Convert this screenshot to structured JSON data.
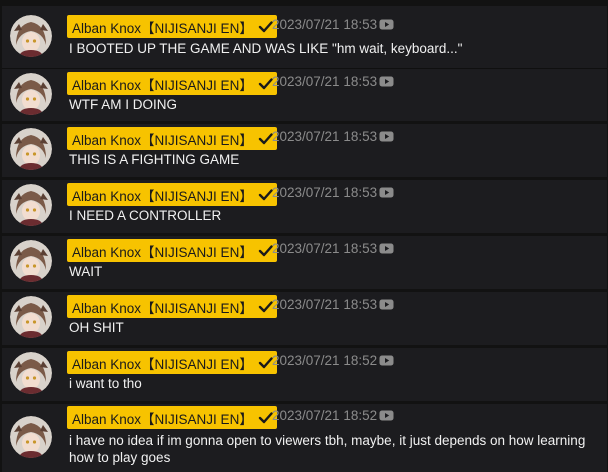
{
  "messages": [
    {
      "author": "Alban Knox【NIJISANJI EN】",
      "timestamp": "2023/07/21 18:53",
      "text": "I BOOTED UP THE GAME AND WAS LIKE \"hm wait, keyboard...\""
    },
    {
      "author": "Alban Knox【NIJISANJI EN】",
      "timestamp": "2023/07/21 18:53",
      "text": "WTF AM I DOING"
    },
    {
      "author": "Alban Knox【NIJISANJI EN】",
      "timestamp": "2023/07/21 18:53",
      "text": "THIS IS A FIGHTING GAME"
    },
    {
      "author": "Alban Knox【NIJISANJI EN】",
      "timestamp": "2023/07/21 18:53",
      "text": "I NEED A CONTROLLER"
    },
    {
      "author": "Alban Knox【NIJISANJI EN】",
      "timestamp": "2023/07/21 18:53",
      "text": "WAIT"
    },
    {
      "author": "Alban Knox【NIJISANJI EN】",
      "timestamp": "2023/07/21 18:53",
      "text": "OH SHIT"
    },
    {
      "author": "Alban Knox【NIJISANJI EN】",
      "timestamp": "2023/07/21 18:52",
      "text": "i want to tho"
    },
    {
      "author": "Alban Knox【NIJISANJI EN】",
      "timestamp": "2023/07/21 18:52",
      "text": "i have no idea if im gonna open to viewers tbh, maybe, it just depends on how learning how to play goes"
    }
  ],
  "icons": {
    "verified": "check-icon",
    "source": "youtube-icon"
  },
  "colors": {
    "badge_background": "#f7c300",
    "row_background": "#1c1c1f",
    "page_background": "#121212",
    "message_text": "#f1f1f1",
    "timestamp_text": "#8b8b8b"
  }
}
